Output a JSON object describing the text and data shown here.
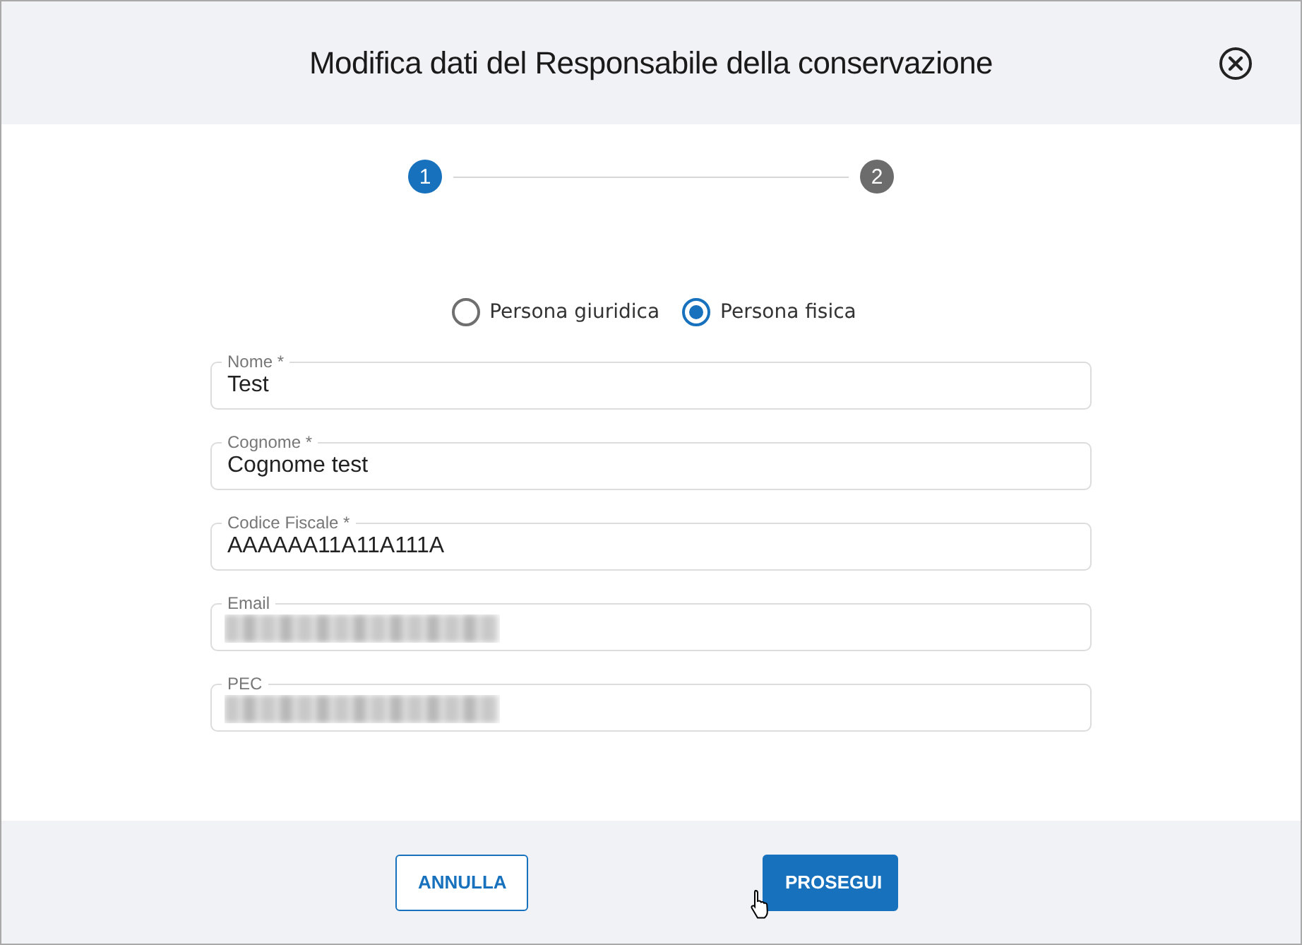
{
  "dialog": {
    "title": "Modifica dati del Responsabile della conservazione"
  },
  "steps": [
    {
      "label": "1",
      "selected": true
    },
    {
      "label": "2",
      "selected": false
    }
  ],
  "person_type": [
    {
      "label": "Persona giuridica",
      "selected": false
    },
    {
      "label": "Persona fisica",
      "selected": true
    }
  ],
  "fields": [
    {
      "label": "Nome *",
      "value": "Test",
      "redacted": false
    },
    {
      "label": "Cognome *",
      "value": "Cognome test",
      "redacted": false
    },
    {
      "label": "Codice Fiscale *",
      "value": "AAAAAA11A11A111A",
      "redacted": false
    },
    {
      "label": "Email",
      "redacted": true
    },
    {
      "label": "PEC",
      "redacted": true
    }
  ],
  "buttons": [
    {
      "label": "ANNULLA",
      "kind": "secondary"
    },
    {
      "label": "PROSEGUI",
      "kind": "primary"
    }
  ]
}
